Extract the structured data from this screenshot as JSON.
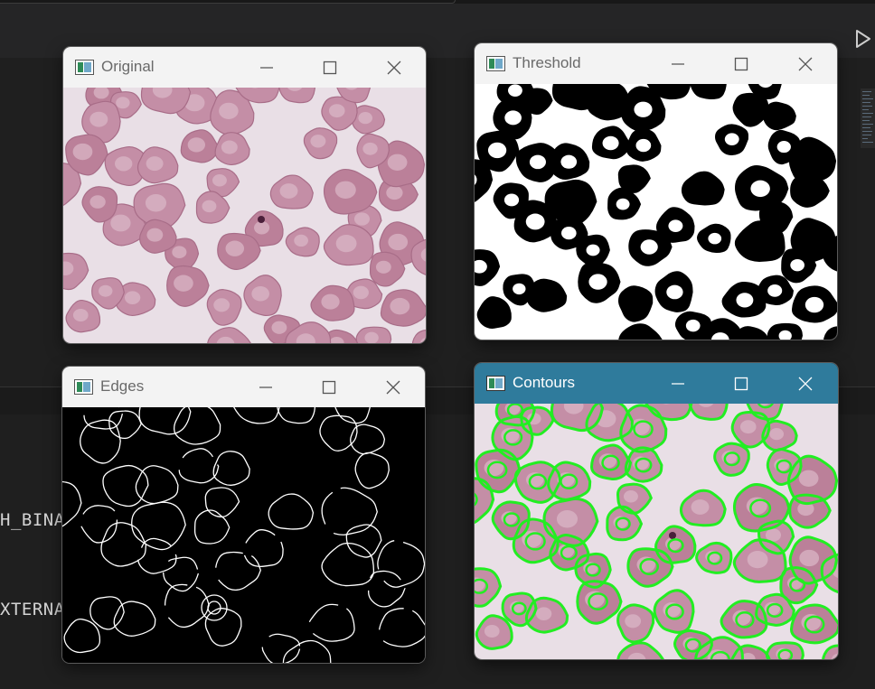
{
  "ide": {
    "code_fragments": [
      "H_BINA",
      "XTERNA"
    ],
    "run_icon": "play-icon"
  },
  "windows": [
    {
      "id": "original",
      "title": "Original",
      "icon": "image-window-icon",
      "active": false,
      "content": "blood cell micrograph (pink cells on light background)"
    },
    {
      "id": "threshold",
      "title": "Threshold",
      "icon": "image-window-icon",
      "active": false,
      "content": "binary threshold image (black cells on white)"
    },
    {
      "id": "edges",
      "title": "Edges",
      "icon": "image-window-icon",
      "active": false,
      "content": "edge map (white outlines on black)"
    },
    {
      "id": "contours",
      "title": "Contours",
      "icon": "image-window-icon",
      "active": true,
      "content": "micrograph with green contour outlines"
    }
  ],
  "window_controls": {
    "minimize": "minimize-icon",
    "maximize": "maximize-icon",
    "close": "close-icon"
  },
  "colors": {
    "ide_bg": "#1f1f1f",
    "titlebar_inactive": "#f3f3f3",
    "titlebar_active": "#2f7b9c",
    "cell_pink": "#c78fa8",
    "background_pale": "#e9dfe6",
    "contour_green": "#22ee22"
  }
}
